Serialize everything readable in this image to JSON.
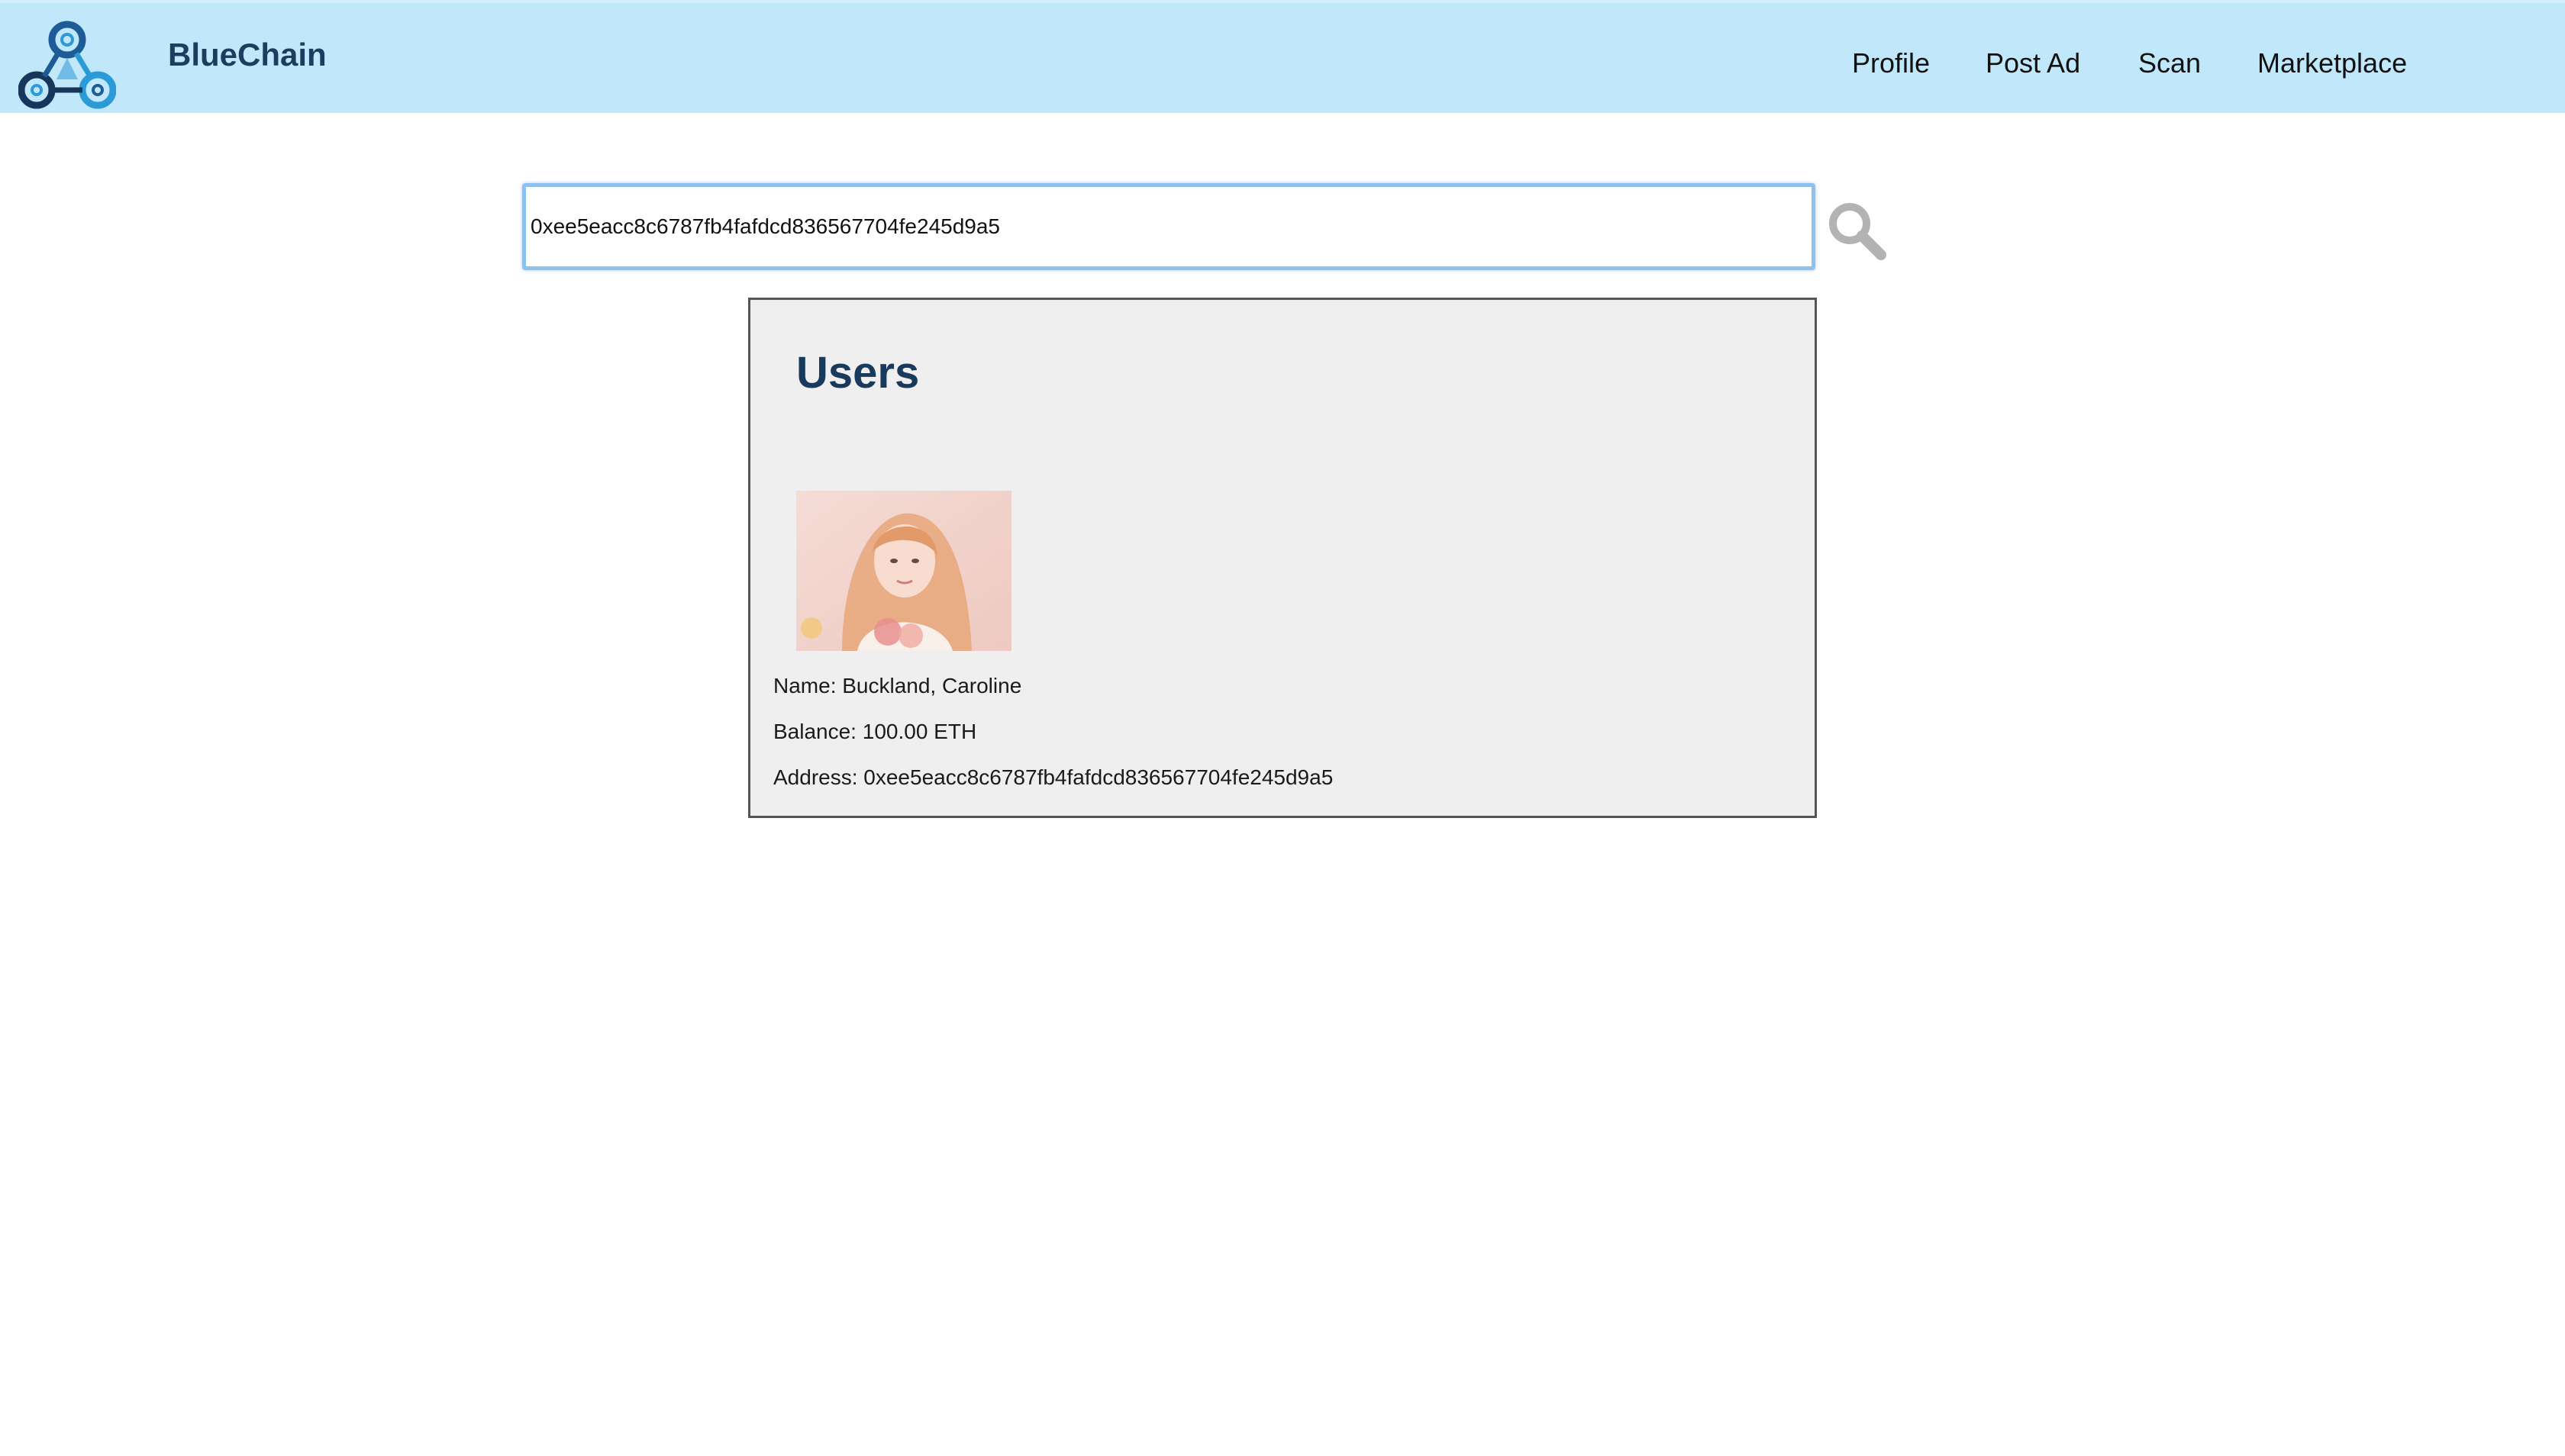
{
  "header": {
    "brand": "BlueChain",
    "nav": [
      {
        "label": "Profile"
      },
      {
        "label": "Post Ad"
      },
      {
        "label": "Scan"
      },
      {
        "label": "Marketplace"
      }
    ],
    "background_color": "#c1e7fb"
  },
  "search": {
    "value": "0xee5eacc8c6787fb4fafdcd836567704fe245d9a5",
    "icon": "search-icon"
  },
  "results": {
    "title": "Users",
    "user": {
      "avatar": "user-photo",
      "name_line": "Name: Buckland, Caroline",
      "balance_line": "Balance: 100.00 ETH",
      "address_line": "Address: 0xee5eacc8c6787fb4fafdcd836567704fe245d9a5"
    }
  },
  "colors": {
    "brand_text": "#1c3d5e",
    "panel_bg": "#efefef",
    "input_focus": "#8ec2ee"
  }
}
